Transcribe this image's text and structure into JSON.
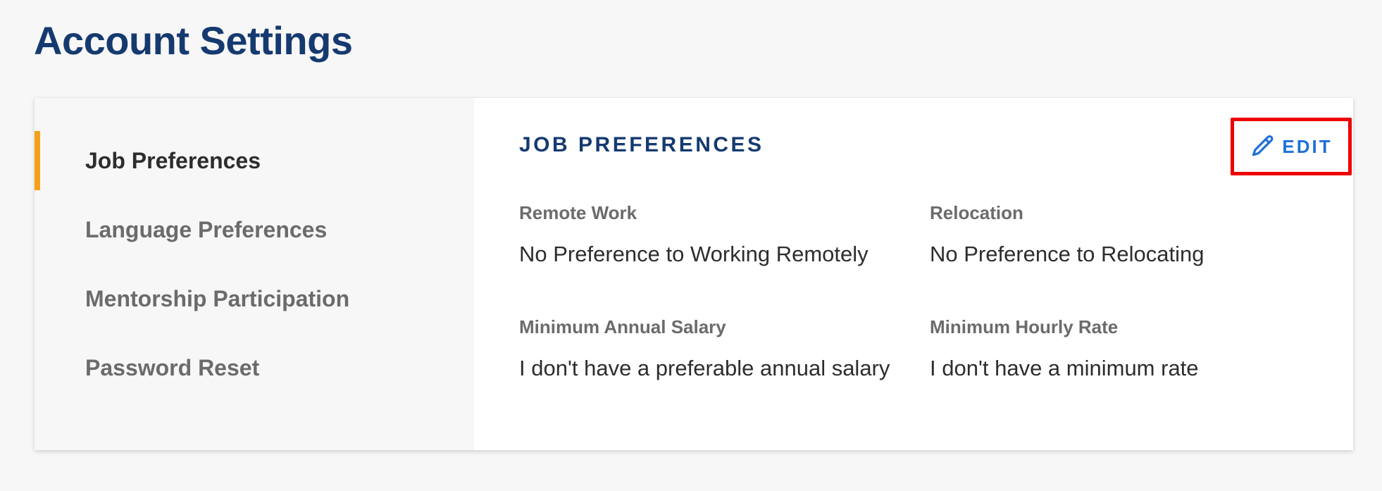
{
  "page": {
    "title": "Account Settings"
  },
  "sidebar": {
    "items": [
      {
        "label": "Job Preferences",
        "active": true
      },
      {
        "label": "Language Preferences",
        "active": false
      },
      {
        "label": "Mentorship Participation",
        "active": false
      },
      {
        "label": "Password Reset",
        "active": false
      }
    ]
  },
  "section": {
    "title": "JOB PREFERENCES",
    "edit_label": "EDIT",
    "edit_icon": "pencil-icon",
    "fields": [
      {
        "label": "Remote Work",
        "value": "No Preference to Working Remotely"
      },
      {
        "label": "Relocation",
        "value": "No Preference to Relocating"
      },
      {
        "label": "Minimum Annual Salary",
        "value": "I don't have a preferable annual salary"
      },
      {
        "label": "Minimum Hourly Rate",
        "value": "I don't have a minimum rate"
      }
    ]
  },
  "colors": {
    "title": "#153a70",
    "accent": "#f5a01a",
    "link": "#1e6fd9",
    "highlight_box": "#ee0000",
    "background": "#f7f7f7"
  }
}
